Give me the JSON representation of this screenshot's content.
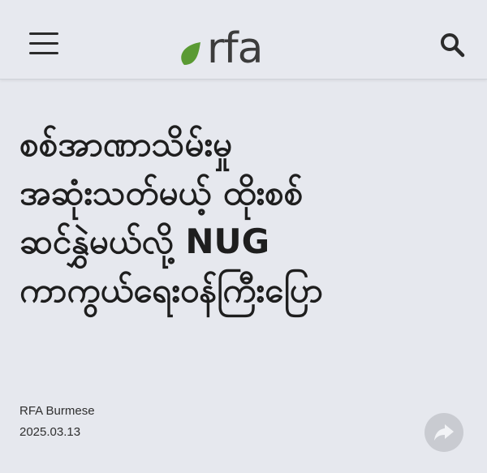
{
  "header": {
    "logo_text": "rfa",
    "brand_color": "#5a9a33",
    "icons": [
      "menu-icon",
      "search-icon"
    ]
  },
  "article": {
    "headline": "စစ်အာဏာသိမ်းမှု\nအဆုံးသတ်မယ့် ထိုးစစ်\nဆင်နွှဲမယ်လို့ NUG\nကာကွယ်ရေးဝန်ကြီးပြော",
    "author": "RFA Burmese",
    "date": "2025.03.13"
  },
  "actions": {
    "share_icon": "share-icon"
  }
}
